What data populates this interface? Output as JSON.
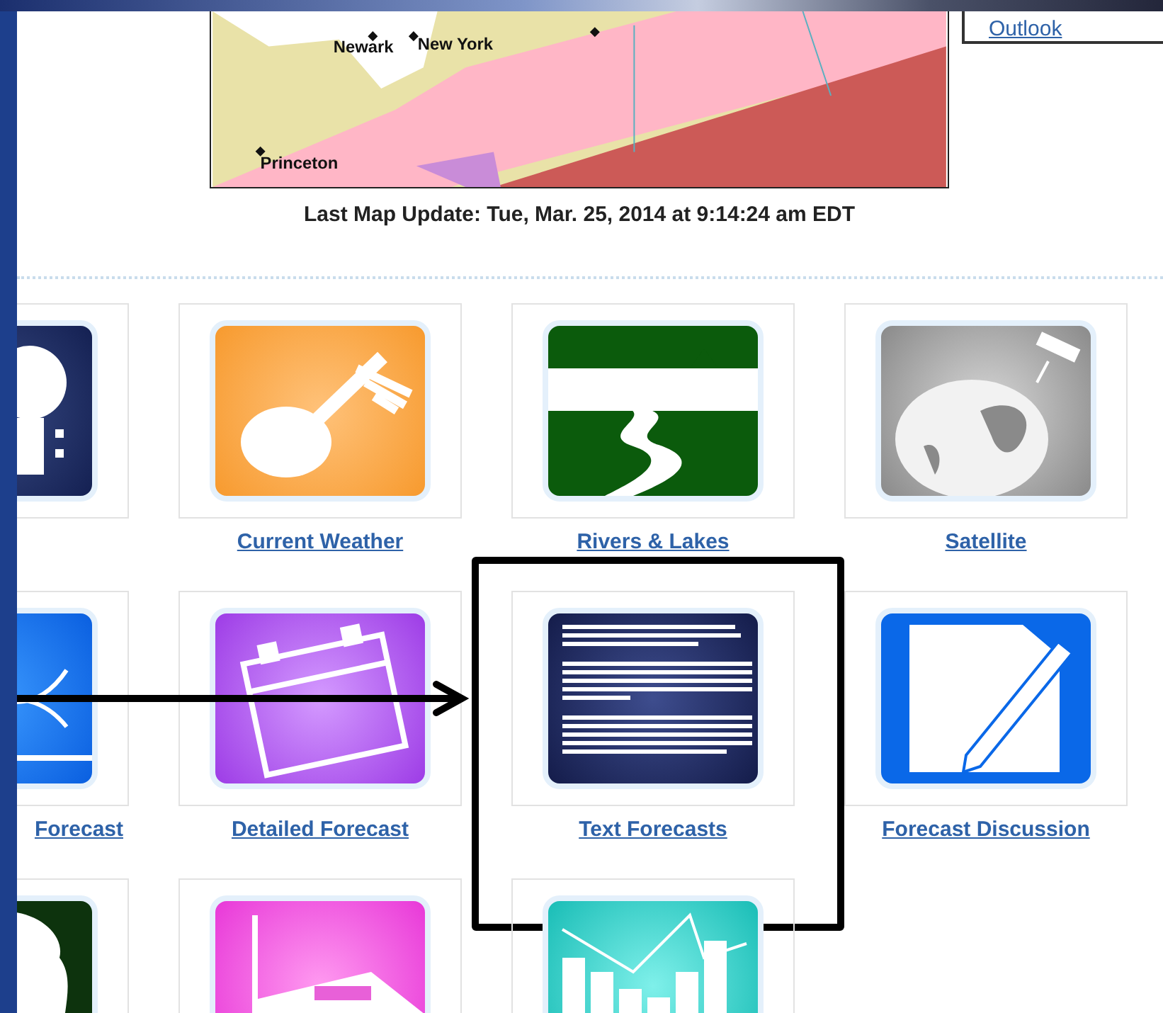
{
  "outlook": {
    "link": "Outlook"
  },
  "map": {
    "cities": [
      "Newark",
      "New York",
      "Princeton"
    ],
    "caption": "Last Map Update: Tue, Mar. 25, 2014 at 9:14:24 am EDT"
  },
  "tiles": [
    {
      "kind": "radar",
      "highlighted": false
    },
    {
      "kind": "current",
      "label": "Current Weather",
      "highlighted": false
    },
    {
      "kind": "rivers",
      "label": "Rivers & Lakes",
      "highlighted": false
    },
    {
      "kind": "satellite",
      "label": "Satellite",
      "highlighted": false
    },
    {
      "kind": "graphical",
      "label": "Forecast",
      "highlighted": false
    },
    {
      "kind": "detailed",
      "label": "Detailed Forecast",
      "highlighted": false
    },
    {
      "kind": "text",
      "label": "Text Forecasts",
      "highlighted": true
    },
    {
      "kind": "discussion",
      "label": "Forecast Discussion",
      "highlighted": false
    },
    {
      "kind": "fire",
      "highlighted": false
    },
    {
      "kind": "radio",
      "highlighted": false
    },
    {
      "kind": "chart",
      "highlighted": false
    }
  ]
}
